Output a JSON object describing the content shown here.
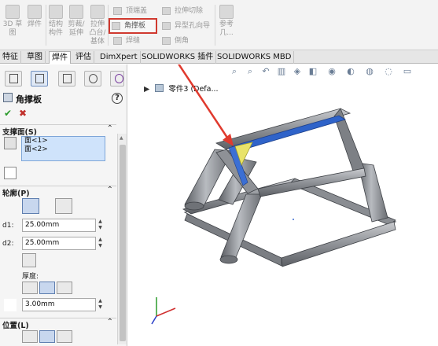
{
  "ribbon": {
    "sketch_3d": "3D 草\n图",
    "weldment": "焊件",
    "structural_member": "结构\n构件",
    "trim_extend": "剪裁/\n延伸",
    "extruded_boss": "拉伸\n凸台/\n基体",
    "end_cap": "顶端盖",
    "gusset": "角撑板",
    "weld_bead": "焊缝",
    "extruded_cut": "拉伸切除",
    "hole_wizard": "异型孔向导",
    "chamfer": "倒角",
    "reference": "参考\n几..."
  },
  "tabs": [
    "特征",
    "草图",
    "焊件",
    "评估",
    "DimXpert",
    "SOLIDWORKS 插件",
    "SOLIDWORKS MBD"
  ],
  "active_tab": "焊件",
  "pm": {
    "title": "角撑板",
    "help": "?",
    "ok": "✔",
    "cancel": "✖",
    "support_faces_label": "支撑面(S)",
    "faces": [
      "面<1>",
      "面<2>"
    ],
    "profile_label": "轮廓(P)",
    "d1_label": "d1:",
    "d1_value": "25.00mm",
    "d2_label": "d2:",
    "d2_value": "25.00mm",
    "thickness_label": "厚度:",
    "t1_value": "3.00mm",
    "position_label": "位置(L)"
  },
  "viewport": {
    "tree_item": "零件3 (Defa..."
  },
  "colors": {
    "highlight_red": "#d0392f",
    "selected_face_blue": "#2f63c9",
    "frame_gray": "#8d8f94",
    "gusset_yellow": "#e8e36a"
  }
}
